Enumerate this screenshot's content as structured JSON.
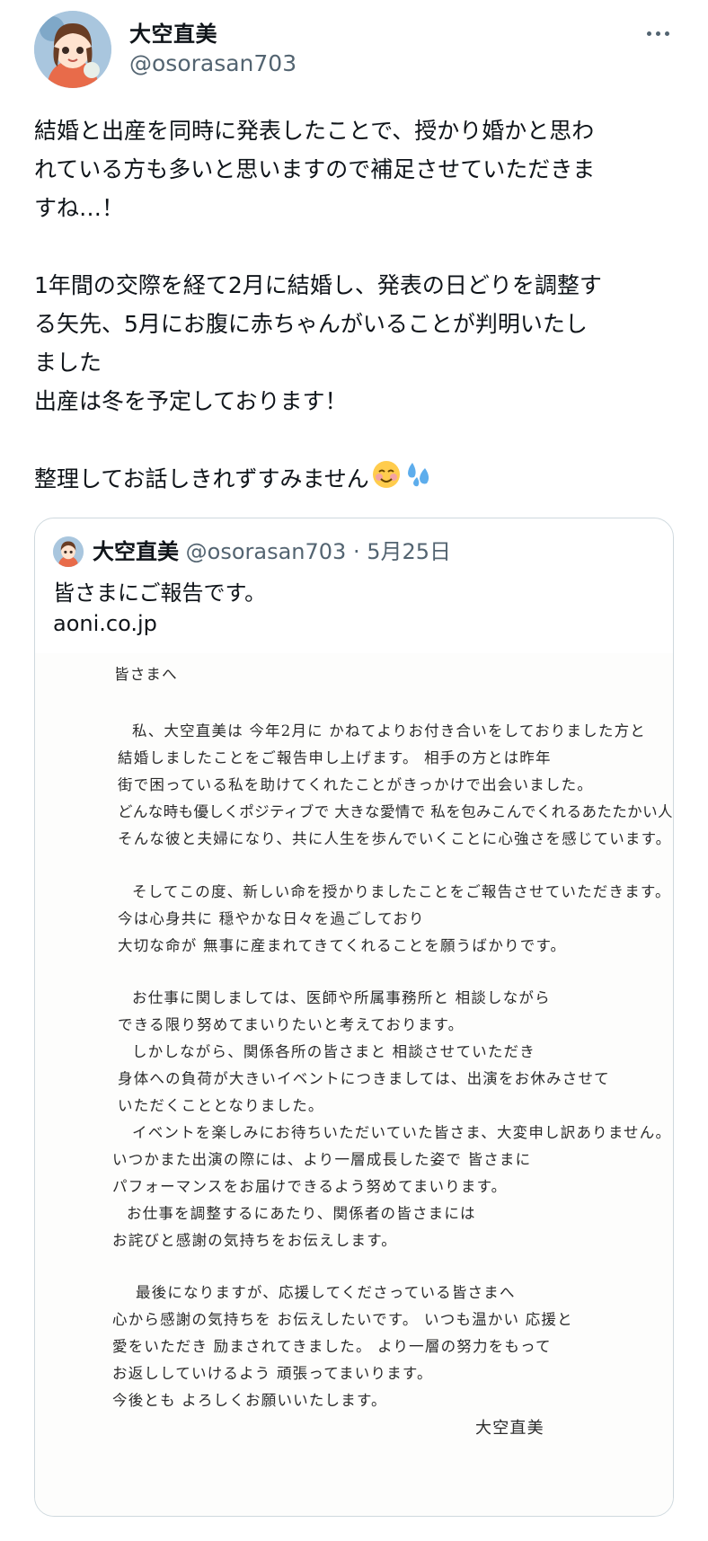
{
  "author": {
    "display_name": "大空直美",
    "handle": "@osorasan703"
  },
  "tweet": {
    "paragraphs": [
      [
        "結婚と出産を同時に発表したことで、授かり婚かと思わ",
        "れている方も多いと思いますので補足させていただきま",
        "すね…！"
      ],
      [
        "1年間の交際を経て2月に結婚し、発表の日どりを調整す",
        "る矢先、5月にお腹に赤ちゃんがいることが判明いたし",
        "ました",
        "出産は冬を予定しております！"
      ],
      [
        "整理してお話しきれずすみません"
      ]
    ],
    "emojis": [
      "smiling-face-icon",
      "sweat-droplets-icon"
    ]
  },
  "quoted": {
    "display_name": "大空直美",
    "handle": "@osorasan703",
    "separator": "·",
    "date": "5月25日",
    "text": "皆さまにご報告です。",
    "link": "aoni.co.jp",
    "letter": {
      "greeting": "皆さまへ",
      "lines": [
        "私、大空直美は 今年2月に かねてよりお付き合いをしておりました方と",
        "結婚しましたことをご報告申し上げます。 相手の方とは昨年",
        "街で困っている私を助けてくれたことがきっかけで出会いました。",
        "どんな時も優しくポジティブで 大きな愛情で 私を包みこんでくれるあたたかい人です。",
        "そんな彼と夫婦になり、共に人生を歩んでいくことに心強さを感じています。",
        "そしてこの度、新しい命を授かりましたことをご報告させていただきます。",
        "今は心身共に 穏やかな日々を過ごしており",
        "大切な命が 無事に産まれてきてくれることを願うばかりです。",
        "お仕事に関しましては、医師や所属事務所と 相談しながら",
        "できる限り努めてまいりたいと考えております。",
        "しかしながら、関係各所の皆さまと 相談させていただき",
        "身体への負荷が大きいイベントにつきましては、出演をお休みさせて",
        "いただくこととなりました。",
        "イベントを楽しみにお待ちいただいていた皆さま、大変申し訳ありません。",
        "いつかまた出演の際には、より一層成長した姿で 皆さまに",
        "パフォーマンスをお届けできるよう努めてまいります。",
        "お仕事を調整するにあたり、関係者の皆さまには",
        "お詫びと感謝の気持ちをお伝えします。",
        "最後になりますが、応援してくださっている皆さまへ",
        "心から感謝の気持ちを お伝えしたいです。 いつも温かい 応援と",
        "愛をいただき 励まされてきました。 より一層の努力をもって",
        "お返ししていけるよう 頑張ってまいります。",
        "今後とも よろしくお願いいたします。"
      ],
      "signature": "大空直美"
    }
  }
}
